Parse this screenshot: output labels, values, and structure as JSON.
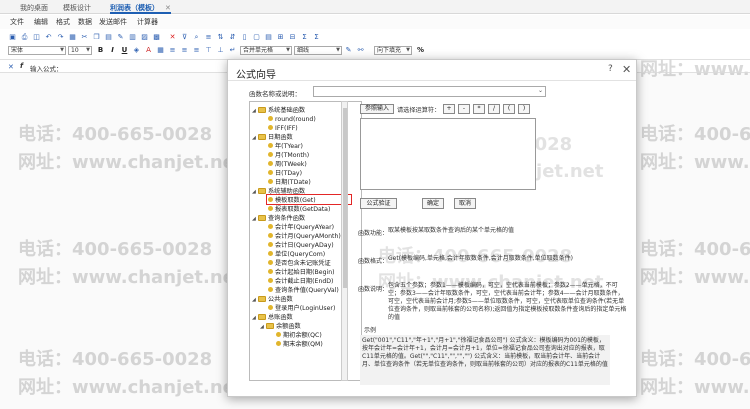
{
  "tabs": [
    {
      "label": "我的桌面"
    },
    {
      "label": "模板设计"
    },
    {
      "label": "利润表（模板）",
      "close": "✕"
    }
  ],
  "menus": [
    "文件",
    "编辑",
    "格式",
    "数据",
    "发送邮件",
    "计算器"
  ],
  "toolbar": {
    "font": "宋体",
    "size": "10",
    "bold": "B",
    "italic": "I",
    "underline": "U",
    "merge": "合并单元格",
    "style": "细线",
    "wrap": "向下填充",
    "percent": "%"
  },
  "formulabar": {
    "label": "输入公式："
  },
  "watermark": {
    "phone": "电话：400-665-0028",
    "site": "网址：www.chanjet.net"
  },
  "dialog": {
    "title": "公式向导",
    "help": "?",
    "close": "✕",
    "search_label": "函数名称或说明：",
    "tree": [
      {
        "label": "系统基础函数",
        "type": "folder"
      },
      {
        "label": "round(round)",
        "type": "item"
      },
      {
        "label": "IFF(IFF)",
        "type": "item"
      },
      {
        "label": "日期函数",
        "type": "folder"
      },
      {
        "label": "年(TYear)",
        "type": "item"
      },
      {
        "label": "月(TMonth)",
        "type": "item"
      },
      {
        "label": "周(TWeek)",
        "type": "item"
      },
      {
        "label": "日(TDay)",
        "type": "item"
      },
      {
        "label": "日期(TDate)",
        "type": "item"
      },
      {
        "label": "系统辅助函数",
        "type": "folder"
      },
      {
        "label": "模板取数(Get)",
        "type": "item"
      },
      {
        "label": "报表取数(GetData)",
        "type": "item"
      },
      {
        "label": "查询条件函数",
        "type": "folder"
      },
      {
        "label": "会计年(QueryAYear)",
        "type": "item"
      },
      {
        "label": "会计月(QueryAMonth)",
        "type": "item"
      },
      {
        "label": "会计日(QueryADay)",
        "type": "item"
      },
      {
        "label": "单位(QueryCom)",
        "type": "item"
      },
      {
        "label": "是否包含未记账凭证",
        "type": "item"
      },
      {
        "label": "会计起始日期(Begin)",
        "type": "item"
      },
      {
        "label": "会计截止日期(EndD)",
        "type": "item"
      },
      {
        "label": "查询条件值(QueryVal)",
        "type": "item"
      },
      {
        "label": "公共函数",
        "type": "folder"
      },
      {
        "label": "登录用户(LoginUser)",
        "type": "item"
      },
      {
        "label": "总账函数",
        "type": "folder"
      },
      {
        "label": "余额函数",
        "type": "folder"
      },
      {
        "label": "期初余额(QC)",
        "type": "item"
      },
      {
        "label": "期末余额(QM)",
        "type": "item"
      }
    ],
    "param_button": "参照输入",
    "operator_label": "请选择运算符：",
    "operators": [
      "+",
      "-",
      "*",
      "/",
      "(",
      ")"
    ],
    "verify_button": "公式验证",
    "ok_button": "确定",
    "cancel_button": "取消",
    "func_label": "函数功能：",
    "func_value": "取某模板按某取数条件查询后的某个单元格的值",
    "format_label": "函数格式：",
    "format_value": "Get(模板编码,单元格,会计年取数条件,会计月取数条件,单位取数条件)",
    "desc_label": "函数说明：",
    "desc_value": "包含五个参数；参数1——模板编码，可空，空代表当前模板；参数2——单元格，不可空；参数3——会计年取数条件，可空，空代表当前会计年；参数4——会计月取数条件，可空，空代表当前会计月;参数5——单位取数条件，可空，空代表取单位查询条件(若无单位查询条件，则取当前帐套的公司名称);返回值为指定模板按取数条件查询后的指定单元格的值",
    "example_title": "示例",
    "example_value": "Get(\"001\",\"C11\",\"年+1\",\"月+1\",\"徐福记食品公司\") 公式含义：模板编码为001的模板，按年会计年=会计年+1，会计月=会计月+1，单位=徐福记食品公司查询出对应的报表，取C11单元格的值。Get(\"\",\"C11\",\"\",\"\",\"\") 公式含义：当前模板，取当前会计年、当前会计月、单位查询条件（若无单位查询条件，则取当前帐套的公司）对应的报表的C11单元格的值"
  }
}
